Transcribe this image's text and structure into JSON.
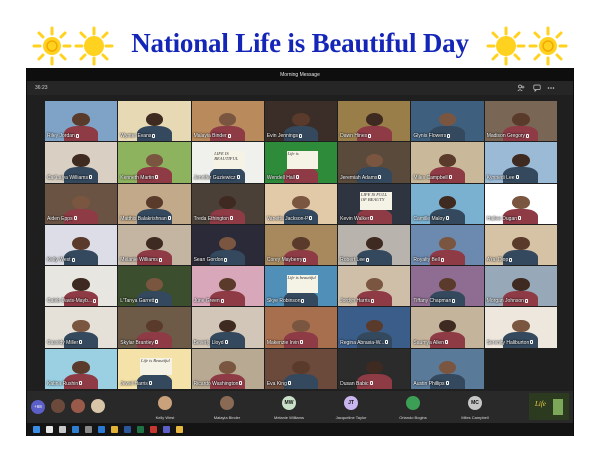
{
  "banner": {
    "title": "National Life is Beautiful Day",
    "title_color": "#1426b8",
    "sun_color": "#ffd21f",
    "icons": [
      "sun-icon",
      "sun-icon",
      "sun-icon",
      "sun-icon"
    ]
  },
  "window": {
    "title": "Morning Message",
    "timer": "36:23",
    "toolbar_icons": [
      "people-icon",
      "chat-icon",
      "raise-hand-icon",
      "more-icon",
      "leave-button"
    ]
  },
  "participants": [
    {
      "name": "Riley Jordan",
      "bg": "#7fa3c7"
    },
    {
      "name": "Wynter Evans",
      "bg": "#e8d9b5"
    },
    {
      "name": "Malayia Binder",
      "bg": "#b88a5c"
    },
    {
      "name": "Evin Jennings",
      "bg": "#3b2e28"
    },
    {
      "name": "Dawn Hines",
      "bg": "#9a7e4a"
    },
    {
      "name": "Glynis Flowers",
      "bg": "#3e5f7d"
    },
    {
      "name": "Madison Gregory",
      "bg": "#7a6655"
    },
    {
      "name": "Car'Laiya Williams",
      "bg": "#d9cfc3"
    },
    {
      "name": "Kenneth Martin",
      "bg": "#8eb35f"
    },
    {
      "name": "Jennifer Guziewicz",
      "bg": "#f0f0ec",
      "sign": "LIFE IS BEAUTIFUL"
    },
    {
      "name": "Wendell Hall",
      "bg": "#2e8b3a",
      "sign": "Life is"
    },
    {
      "name": "Jeremiah Adams",
      "bg": "#5a4a3c"
    },
    {
      "name": "Miles Campbell",
      "bg": "#c9b99a"
    },
    {
      "name": "Kynnedi Lee",
      "bg": "#9bbad6"
    },
    {
      "name": "Aiden Epps",
      "bg": "#6b5344"
    },
    {
      "name": "Matthis Balakrishnan",
      "bg": "#c2a98a"
    },
    {
      "name": "Treda Ethington",
      "bg": "#4a4038"
    },
    {
      "name": "Vanetta Jackson-P",
      "bg": "#e2c9a8"
    },
    {
      "name": "Kevin Walker",
      "bg": "#2f3540",
      "sign": "LIFE IS FULL OF BEAUTY"
    },
    {
      "name": "Camille Maloy",
      "bg": "#7ab0d0"
    },
    {
      "name": "Hailee Dugan",
      "bg": "#ffffff"
    },
    {
      "name": "Kelly West",
      "bg": "#dcdde6"
    },
    {
      "name": "Melanie Williams",
      "bg": "#c4b5a3"
    },
    {
      "name": "Sean Gordon",
      "bg": "#2a2a38"
    },
    {
      "name": "Corey Mayberry",
      "bg": "#a8895e"
    },
    {
      "name": "Robert Lee",
      "bg": "#b9b3ad"
    },
    {
      "name": "Royalty Bell",
      "bg": "#6c89b0"
    },
    {
      "name": "A'rai Diop",
      "bg": "#d6c2a4"
    },
    {
      "name": "Caleb Davis-Mayb...",
      "bg": "#e7e6e0"
    },
    {
      "name": "L'Tanya Garrett",
      "bg": "#3b4e2d"
    },
    {
      "name": "June Green",
      "bg": "#d8a7b9"
    },
    {
      "name": "Skye Robinson",
      "bg": "#4f8fb8",
      "sign": "Life is beautiful"
    },
    {
      "name": "Jordyn Harris",
      "bg": "#cfbfa8"
    },
    {
      "name": "Tiffany Chapman",
      "bg": "#8f6d92"
    },
    {
      "name": "Morgan Johnson",
      "bg": "#97a9b9"
    },
    {
      "name": "Cassidy Miller",
      "bg": "#e5e1d9"
    },
    {
      "name": "Skylar Brantley",
      "bg": "#6d5a47"
    },
    {
      "name": "Beverly Lloyd",
      "bg": "#d1c6b8"
    },
    {
      "name": "Makenzie Irvin",
      "bg": "#a86f4e"
    },
    {
      "name": "Regina Abrasia-W...",
      "bg": "#3a5d8a"
    },
    {
      "name": "Saumya Allen",
      "bg": "#c5b49c"
    },
    {
      "name": "Serenity Haliburton",
      "bg": "#eee7dd"
    },
    {
      "name": "Katina Rushin",
      "bg": "#9ad0e2"
    },
    {
      "name": "Jewel Harris",
      "bg": "#f4e2a8",
      "sign": "Life is Beautiful"
    },
    {
      "name": "Ricardo Washington",
      "bg": "#b8a992"
    },
    {
      "name": "Eva King",
      "bg": "#6b4a3c"
    },
    {
      "name": "Dusan Babic",
      "bg": "#2b2b2b"
    },
    {
      "name": "Austin Phillips",
      "bg": "#5a7a9a"
    },
    {
      "name": "",
      "bg": "#1f1f1f"
    }
  ],
  "strip": {
    "badge": "+68",
    "items": [
      {
        "name": "Kelly West",
        "initials": "",
        "color": "#c9a27c"
      },
      {
        "name": "Malayia Binder",
        "initials": "",
        "color": "#8a6a55"
      },
      {
        "name": "Melanie Williams",
        "initials": "MW",
        "color": "#c8e0c8"
      },
      {
        "name": "Jacqueline Taylor",
        "initials": "JT",
        "color": "#cab6ee"
      },
      {
        "name": "Orlando Bogins",
        "initials": "",
        "color": "#3ba055"
      },
      {
        "name": "Miles Campbell",
        "initials": "MC",
        "color": "#c6c6c6"
      }
    ]
  },
  "taskbar": {
    "icons": [
      "windows-icon",
      "search-icon",
      "task-view-icon",
      "edge-icon",
      "store-icon",
      "mail-icon",
      "chrome-icon",
      "word-icon",
      "excel-icon",
      "acrobat-icon",
      "teams-icon",
      "file-explorer-icon"
    ]
  }
}
